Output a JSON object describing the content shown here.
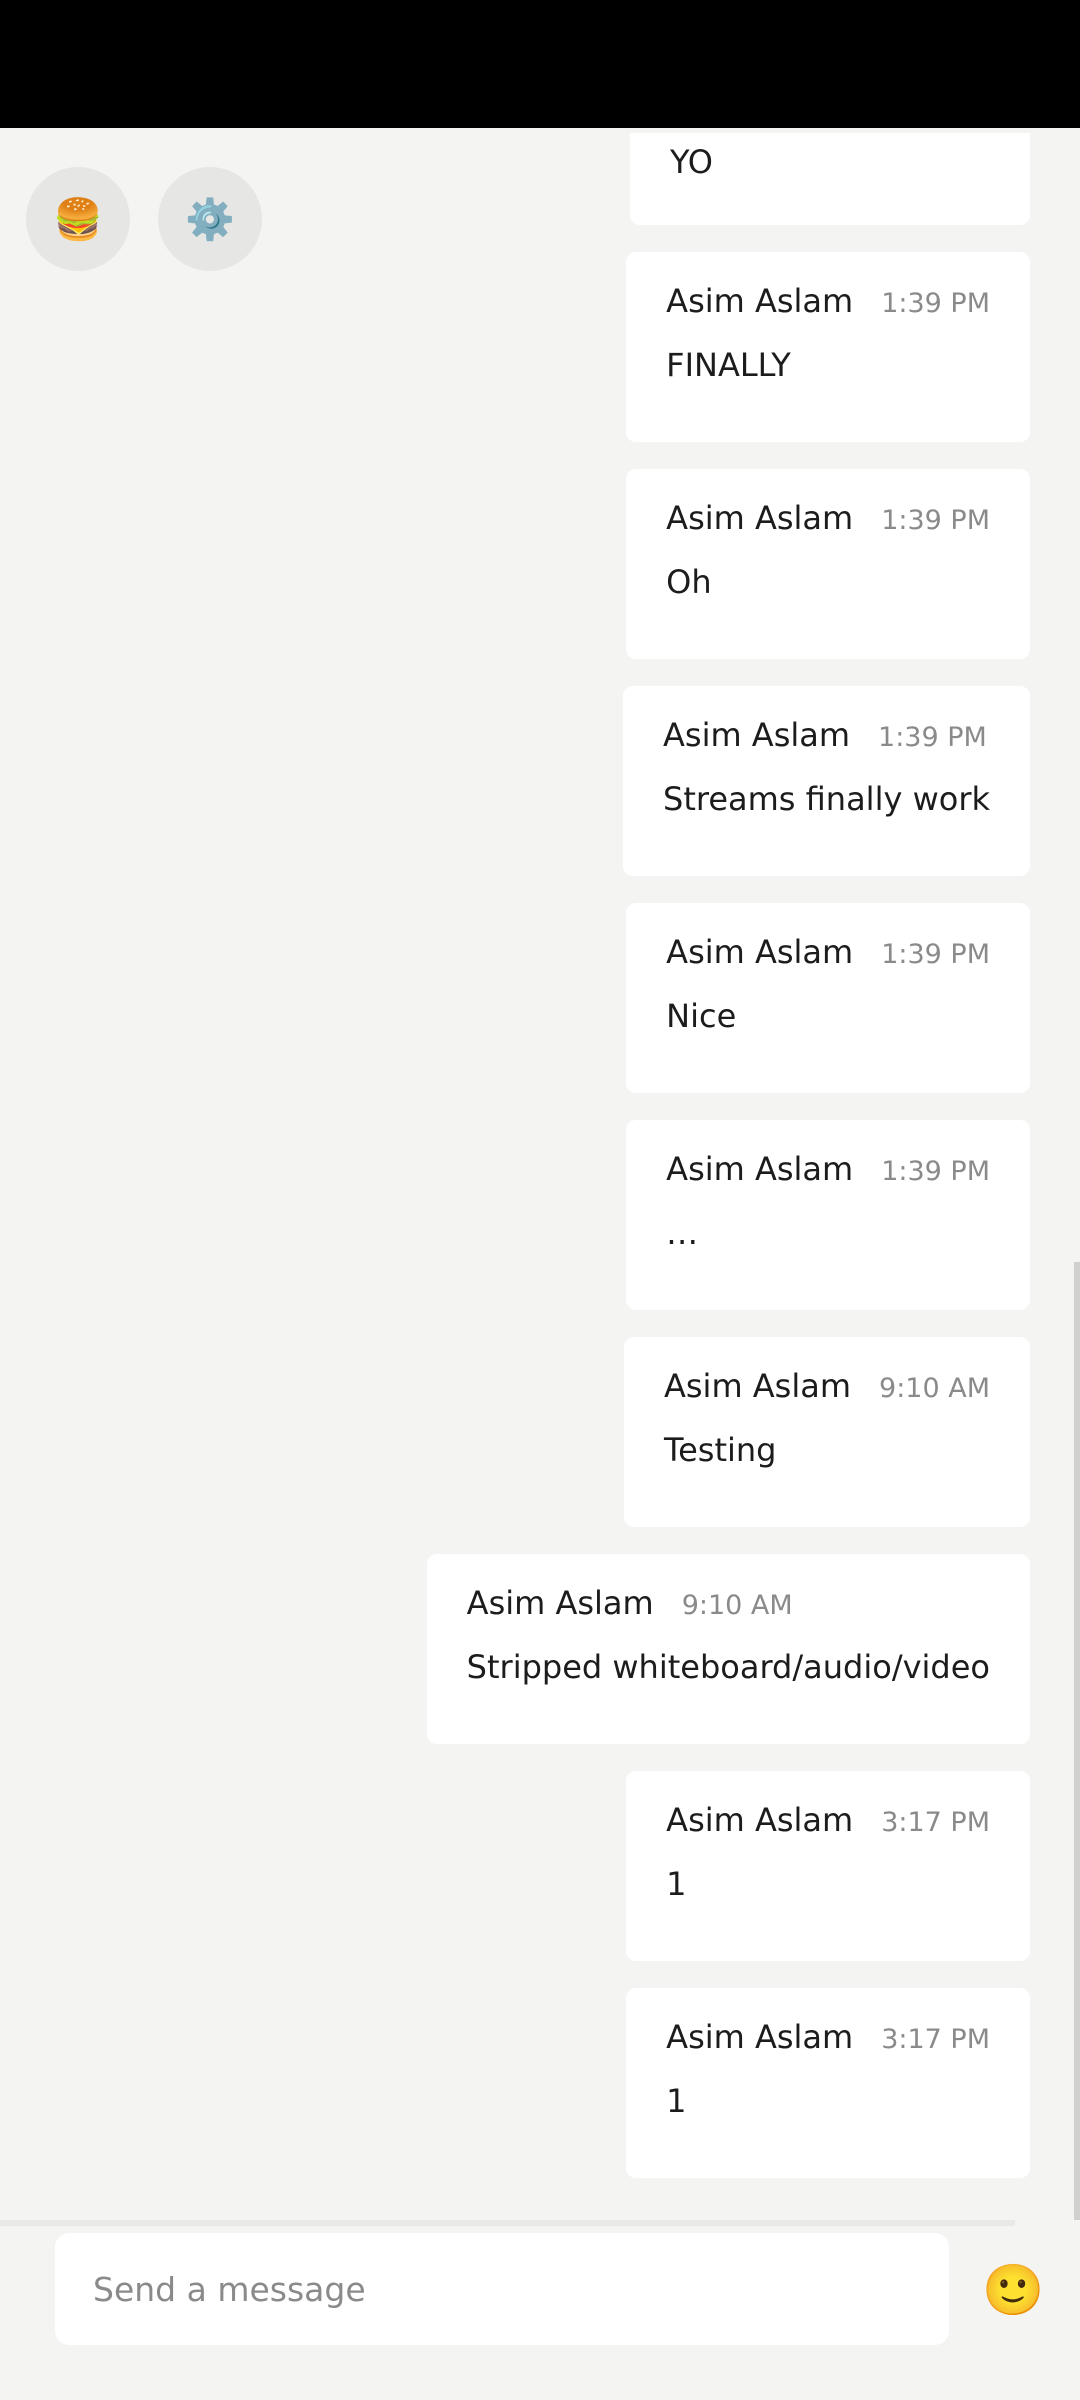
{
  "top_actions": {
    "menu_icon": "🍔",
    "settings_icon": "⚙️"
  },
  "messages": [
    {
      "text": "YO"
    },
    {
      "author": "Asim Aslam",
      "time": "1:39 PM",
      "text": "FINALLY"
    },
    {
      "author": "Asim Aslam",
      "time": "1:39 PM",
      "text": "Oh"
    },
    {
      "author": "Asim Aslam",
      "time": "1:39 PM",
      "text": "Streams finally work"
    },
    {
      "author": "Asim Aslam",
      "time": "1:39 PM",
      "text": "Nice"
    },
    {
      "author": "Asim Aslam",
      "time": "1:39 PM",
      "text": "…"
    },
    {
      "author": "Asim Aslam",
      "time": "9:10 AM",
      "text": "Testing"
    },
    {
      "author": "Asim Aslam",
      "time": "9:10 AM",
      "text": "Stripped whiteboard/audio/video"
    },
    {
      "author": "Asim Aslam",
      "time": "3:17 PM",
      "text": "1"
    },
    {
      "author": "Asim Aslam",
      "time": "3:17 PM",
      "text": "1"
    }
  ],
  "composer": {
    "placeholder": "Send a message",
    "emoji_icon": "🙂"
  }
}
